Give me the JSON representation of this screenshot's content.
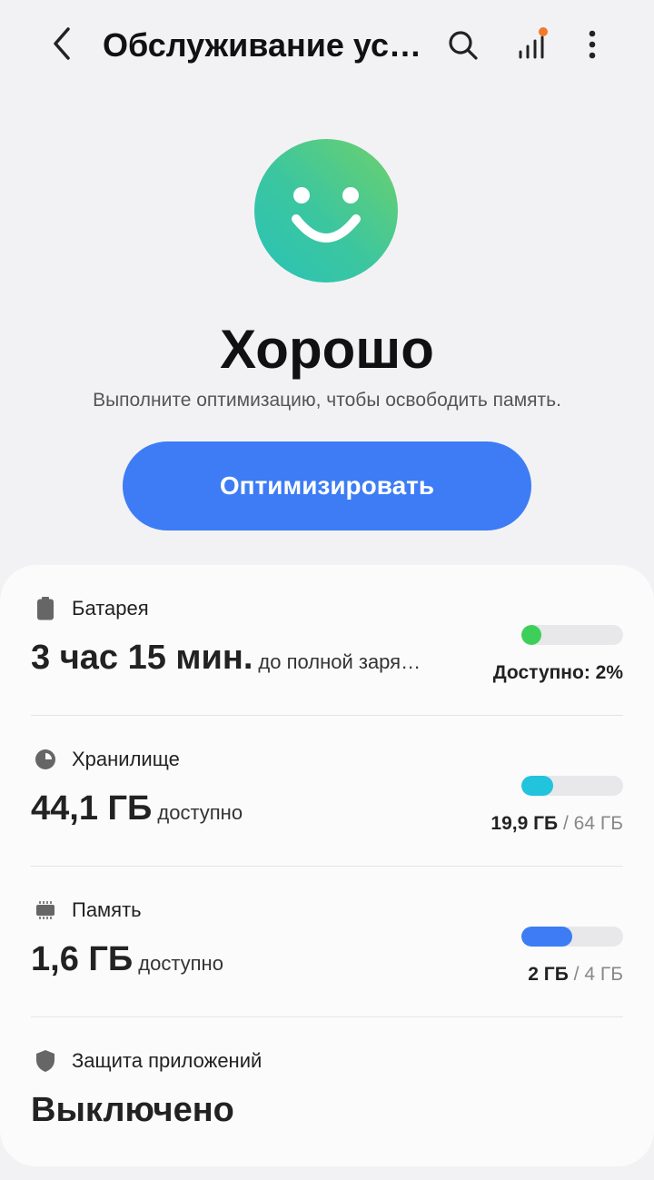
{
  "header": {
    "title": "Обслуживание ус…",
    "back_icon": "chevron-left-icon",
    "search_icon": "search-icon",
    "signal_icon": "signal-bars-icon",
    "more_icon": "more-vertical-icon"
  },
  "status": {
    "face_icon": "smiley-face-icon",
    "title": "Хорошо",
    "subtitle": "Выполните оптимизацию, чтобы освободить память.",
    "button_label": "Оптимизировать",
    "button_color": "#3d7cf5"
  },
  "battery": {
    "label": "Батарея",
    "icon": "battery-icon",
    "value": "3 час 15 мин.",
    "suffix": "до полной заря…",
    "available_text": "Доступно: 2%",
    "level_fraction": 0.02,
    "color": "#3ecf5a"
  },
  "storage": {
    "label": "Хранилище",
    "icon": "storage-pie-icon",
    "value": "44,1 ГБ",
    "suffix": "доступно",
    "used": "19,9 ГБ",
    "separator": "/",
    "total": "64 ГБ",
    "used_fraction": 0.31,
    "color": "#22c3dc"
  },
  "memory": {
    "label": "Память",
    "icon": "memory-chip-icon",
    "value": "1,6 ГБ",
    "suffix": "доступно",
    "used": "2 ГБ",
    "separator": "/",
    "total": "4 ГБ",
    "used_fraction": 0.5,
    "color": "#3d7cf5"
  },
  "app_protection": {
    "label": "Защита приложений",
    "icon": "shield-icon",
    "value": "Выключено"
  }
}
